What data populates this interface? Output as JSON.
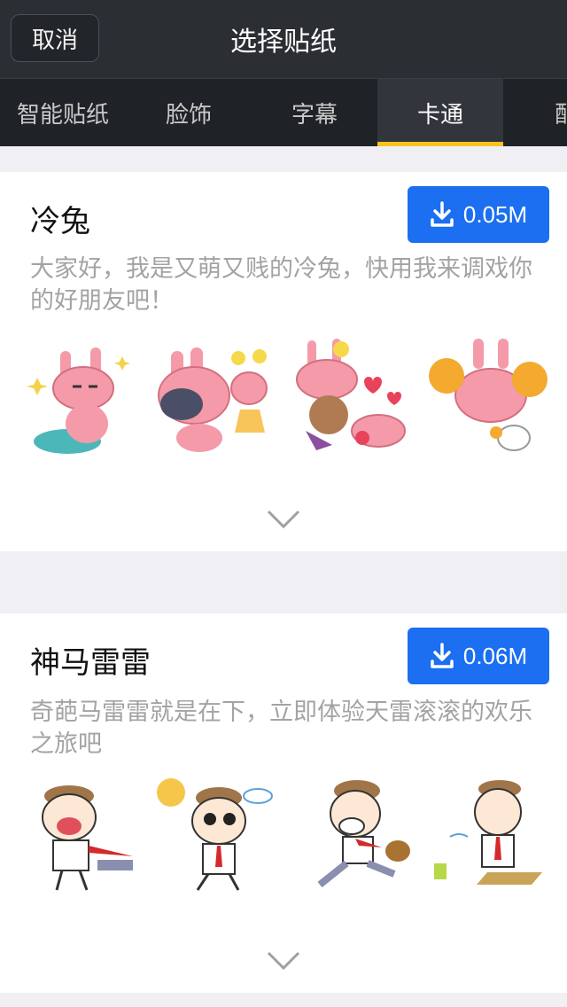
{
  "header": {
    "cancel": "取消",
    "title": "选择贴纸"
  },
  "tabs": [
    "智能贴纸",
    "脸饰",
    "字幕",
    "卡通",
    "配"
  ],
  "active_tab": 3,
  "cards": [
    {
      "title": "冷兔",
      "size": "0.05M",
      "desc": "大家好，我是又萌又贱的冷兔，快用我来调戏你的好朋友吧！"
    },
    {
      "title": "神马雷雷",
      "size": "0.06M",
      "desc": "奇葩马雷雷就是在下，立即体验天雷滚滚的欢乐之旅吧"
    }
  ],
  "colors": {
    "accent": "#f5c41e",
    "download": "#1b6ff0",
    "rabbit": "#f49aa8"
  },
  "icons": {
    "download": "download-icon",
    "expand": "chevron-down-icon"
  }
}
